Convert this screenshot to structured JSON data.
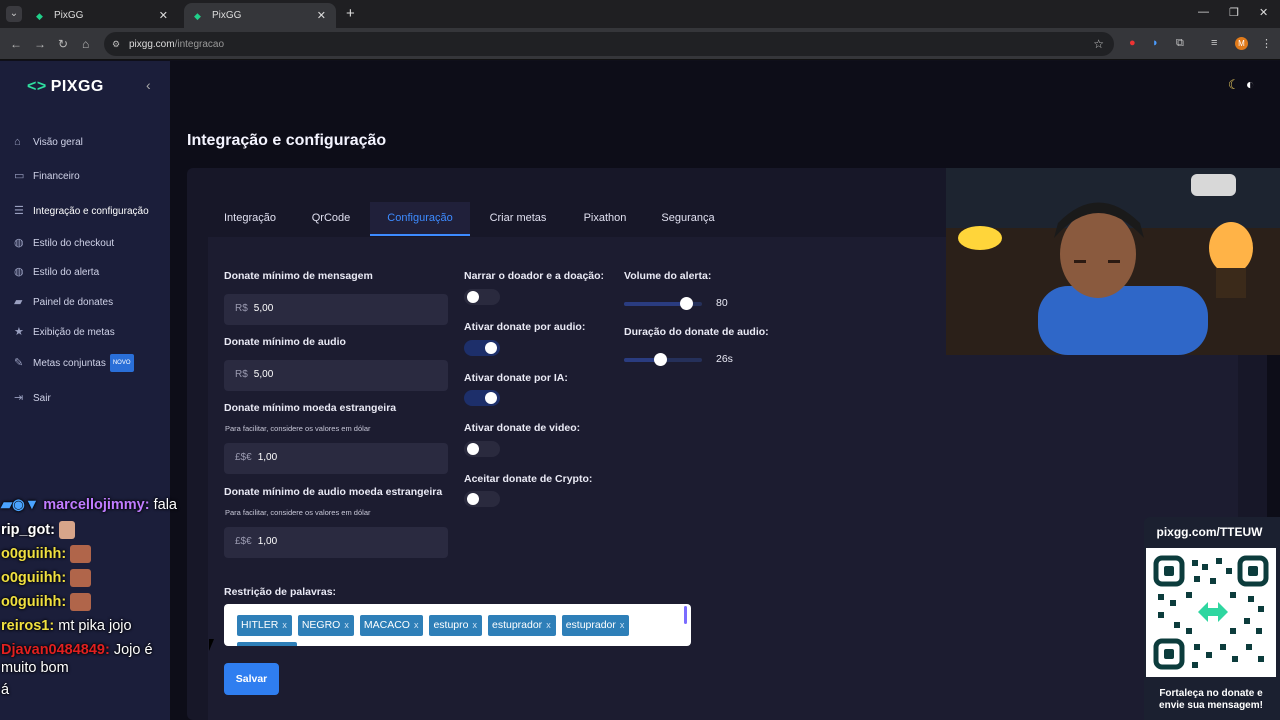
{
  "browser": {
    "tabs": [
      {
        "title": "PixGG",
        "close": "✕"
      },
      {
        "title": "PixGG",
        "close": "✕"
      }
    ],
    "new_tab": "+",
    "window_controls": [
      "—",
      "❐",
      "✕"
    ],
    "nav_icons": [
      "back-icon",
      "forward-icon",
      "reload-icon",
      "home-icon"
    ],
    "url_host": "pixgg.com",
    "url_path": "/integracao",
    "profile_initial": "M"
  },
  "sidebar": {
    "brand": "PIXGG",
    "items": [
      {
        "label": "Visão geral",
        "icon": "home-icon"
      },
      {
        "label": "Financeiro",
        "icon": "wallet-icon"
      },
      {
        "label": "Integração e configuração",
        "icon": "list-icon"
      },
      {
        "label": "Estilo do checkout",
        "icon": "palette-icon"
      },
      {
        "label": "Estilo do alerta",
        "icon": "palette-icon"
      },
      {
        "label": "Painel de donates",
        "icon": "folder-icon"
      },
      {
        "label": "Exibição de metas",
        "icon": "star-icon"
      },
      {
        "label": "Metas conjuntas",
        "icon": "wand-icon",
        "badge": "NOVO"
      },
      {
        "label": "Sair",
        "icon": "logout-icon"
      }
    ]
  },
  "page": {
    "title": "Integração e configuração",
    "tabs": [
      "Integração",
      "QrCode",
      "Configuração",
      "Criar metas",
      "Pixathon",
      "Segurança"
    ],
    "active_tab": "Configuração"
  },
  "form": {
    "min_message_label": "Donate mínimo de mensagem",
    "min_message_currency": "R$",
    "min_message_value": "5,00",
    "min_audio_label": "Donate mínimo de audio",
    "min_audio_currency": "R$",
    "min_audio_value": "5,00",
    "min_foreign_label": "Donate mínimo moeda estrangeira",
    "min_foreign_hint": "Para facilitar, considere os valores em dólar",
    "min_foreign_currency": "£$€",
    "min_foreign_value": "1,00",
    "min_foreign_audio_label": "Donate mínimo de audio moeda estrangeira",
    "min_foreign_audio_hint": "Para facilitar, considere os valores em dólar",
    "min_foreign_audio_currency": "£$€",
    "min_foreign_audio_value": "1,00",
    "toggles": [
      {
        "label": "Narrar o doador e a doação:",
        "on": false
      },
      {
        "label": "Ativar donate por audio:",
        "on": true
      },
      {
        "label": "Ativar donate por IA:",
        "on": true
      },
      {
        "label": "Ativar donate de video:",
        "on": false
      },
      {
        "label": "Aceitar donate de Crypto:",
        "on": false
      }
    ],
    "volume_label": "Volume do alerta:",
    "volume_value": "80",
    "volume_level": 0.8,
    "audio_duration_label": "Duração do donate de audio:",
    "audio_duration_value": "26s",
    "audio_duration_level": 0.46,
    "restriction_label": "Restrição de palavras:",
    "restricted_words": [
      "HITLER",
      "NEGRO",
      "MACACO",
      "estupro",
      "estuprador",
      "estuprador"
    ],
    "tag_remove": "x",
    "save_label": "Salvar"
  },
  "chat": [
    {
      "user": "marcellojimmy:",
      "user_color": "#c07cff",
      "text": "fala"
    },
    {
      "user": "rip_got:",
      "user_color": "#ffffff",
      "text": ""
    },
    {
      "user": "o0guiihh:",
      "user_color": "#f0e040",
      "text": ""
    },
    {
      "user": "o0guiihh:",
      "user_color": "#f0e040",
      "text": ""
    },
    {
      "user": "o0guiihh:",
      "user_color": "#f0e040",
      "text": ""
    },
    {
      "user": "reiros1:",
      "user_color": "#f0e040",
      "text": "mt pika jojo"
    },
    {
      "user": "Djavan0484849:",
      "user_color": "#e02020",
      "text": "Jojo é"
    },
    {
      "user": "",
      "user_color": "#ffffff",
      "text": "muito bom"
    },
    {
      "user": "",
      "user_color": "#ffffff",
      "text": "á"
    }
  ],
  "qr_overlay": {
    "url": "pixgg.com/TTEUW",
    "caption_line1": "Fortaleça no donate e",
    "caption_line2": "envie sua mensagem!"
  }
}
